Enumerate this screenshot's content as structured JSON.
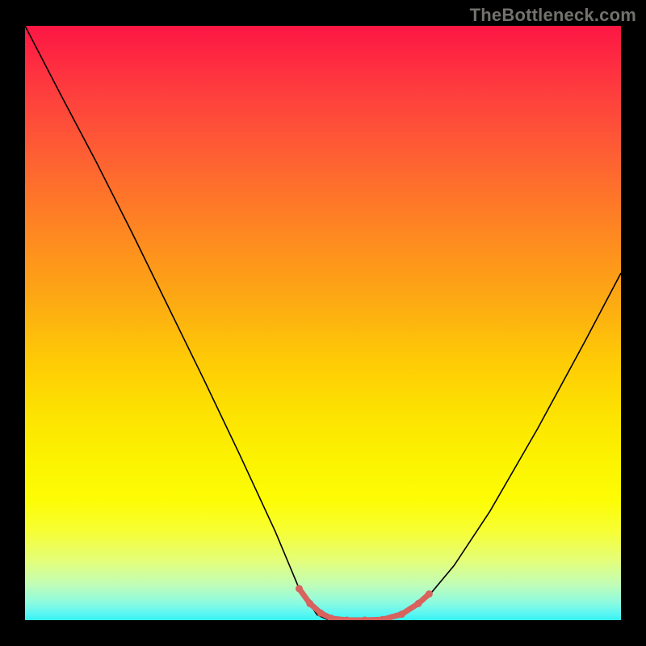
{
  "watermark": "TheBottleneck.com",
  "chart_data": {
    "type": "line",
    "title": "",
    "xlabel": "",
    "ylabel": "",
    "xlim": [
      0,
      1
    ],
    "ylim": [
      0,
      1
    ],
    "annotations": [],
    "grid": false,
    "legend": false,
    "series": [
      {
        "name": "curve",
        "x": [
          0.0,
          0.06,
          0.12,
          0.18,
          0.24,
          0.3,
          0.36,
          0.42,
          0.46,
          0.49,
          0.51,
          0.53,
          0.56,
          0.59,
          0.62,
          0.65,
          0.68,
          0.72,
          0.78,
          0.86,
          0.94,
          1.0
        ],
        "y": [
          1.0,
          0.884,
          0.77,
          0.651,
          0.528,
          0.405,
          0.279,
          0.149,
          0.053,
          0.009,
          0.0,
          0.0,
          0.0,
          0.0,
          0.006,
          0.019,
          0.044,
          0.092,
          0.183,
          0.322,
          0.47,
          0.584
        ]
      },
      {
        "name": "marker-segment",
        "x": [
          0.46,
          0.478,
          0.496,
          0.514,
          0.54,
          0.57,
          0.6,
          0.632,
          0.66,
          0.678
        ],
        "y": [
          0.053,
          0.028,
          0.012,
          0.003,
          0.0,
          0.0,
          0.001,
          0.01,
          0.028,
          0.044
        ]
      }
    ],
    "colors": {
      "curve": "#000000",
      "markers": "#d8625e",
      "background_gradient": [
        "#fd1644",
        "#fe8821",
        "#fdfd06",
        "#35f0f0"
      ]
    }
  }
}
